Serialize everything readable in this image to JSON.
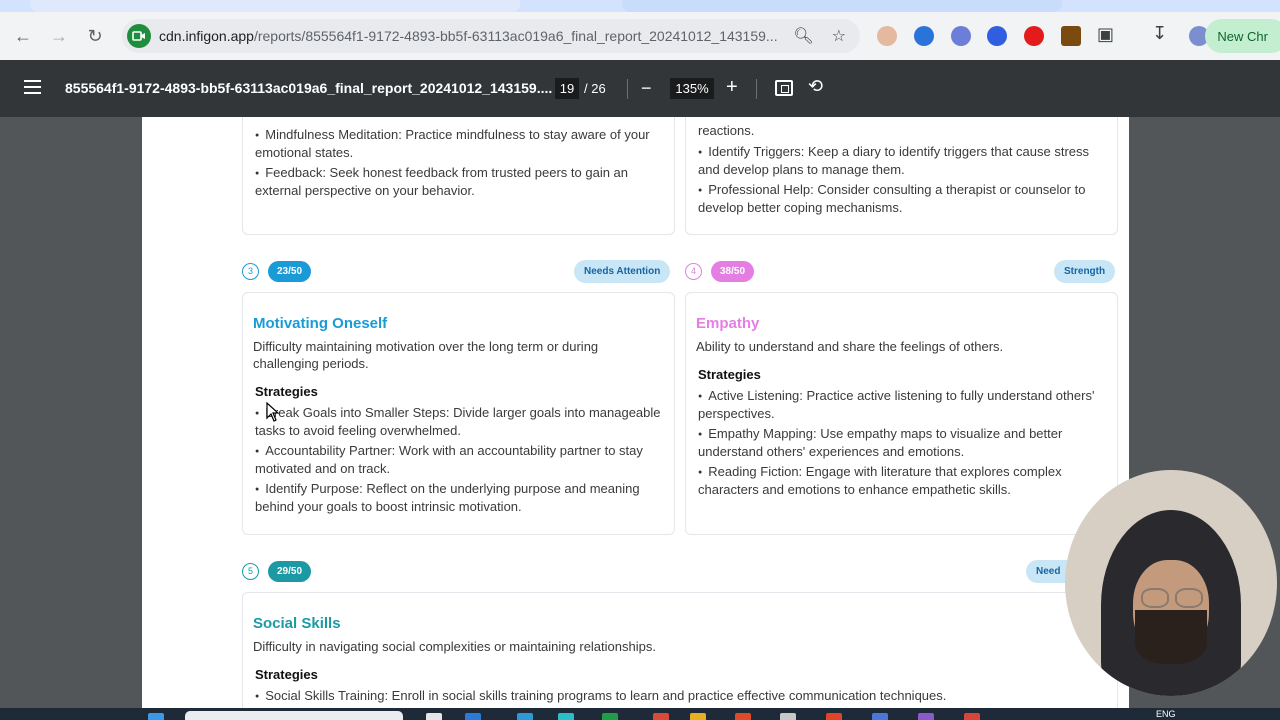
{
  "browser": {
    "url_host": "cdn.infigon.app",
    "url_path": "/reports/855564f1-9172-4893-bb5f-63113ac019a6_final_report_20241012_143159...",
    "new_chrome_label": "New Chr"
  },
  "pdf_toolbar": {
    "title": "855564f1-9172-4893-bb5f-63113ac019a6_final_report_20241012_143159....",
    "current_page": "19",
    "total_pages": "/ 26",
    "zoom": "135%"
  },
  "page": {
    "card1_bullets": [
      "Mindfulness Meditation: Practice mindfulness to stay aware of your emotional states.",
      "Feedback: Seek honest feedback from trusted peers to gain an external perspective on your behavior."
    ],
    "card2_top_fragment": "reactions.",
    "card2_bullets": [
      "Identify Triggers: Keep a diary to identify triggers that cause stress and develop plans to manage them.",
      "Professional Help: Consider consulting a therapist or counselor to develop better coping mechanisms."
    ],
    "section3": {
      "number": "3",
      "score": "23/50",
      "badge": "Needs Attention",
      "title": "Motivating Oneself",
      "description": "Difficulty maintaining motivation over the long term or during challenging periods.",
      "strategies_label": "Strategies",
      "bullets": [
        "Break Goals into Smaller Steps: Divide larger goals into manageable tasks to avoid feeling overwhelmed.",
        "Accountability Partner: Work with an accountability partner to stay motivated and on track.",
        "Identify Purpose: Reflect on the underlying purpose and meaning behind your goals to boost intrinsic motivation."
      ]
    },
    "section4": {
      "number": "4",
      "score": "38/50",
      "badge": "Strength",
      "title": "Empathy",
      "description": "Ability to understand and share the feelings of others.",
      "strategies_label": "Strategies",
      "bullets": [
        "Active Listening: Practice active listening to fully understand others' perspectives.",
        "Empathy Mapping: Use empathy maps to visualize and better understand others' experiences and emotions.",
        "Reading Fiction: Engage with literature that explores complex characters and emotions to enhance empathetic skills."
      ]
    },
    "section5": {
      "number": "5",
      "score": "29/50",
      "badge": "Need",
      "title": "Social Skills",
      "description": "Difficulty in navigating social complexities or maintaining relationships.",
      "strategies_label": "Strategies",
      "bullets": [
        "Social Skills Training: Enroll in social skills training programs to learn and practice effective communication techniques."
      ]
    }
  },
  "taskbar": {
    "language": "ENG"
  },
  "colors": {
    "blue_accent": "#1a9bd7",
    "pink_accent": "#e57ee3",
    "teal_accent": "#1b9aa6",
    "needs_attention_bg": "#c8e6f6",
    "strength_bg": "#c8e6f6"
  }
}
